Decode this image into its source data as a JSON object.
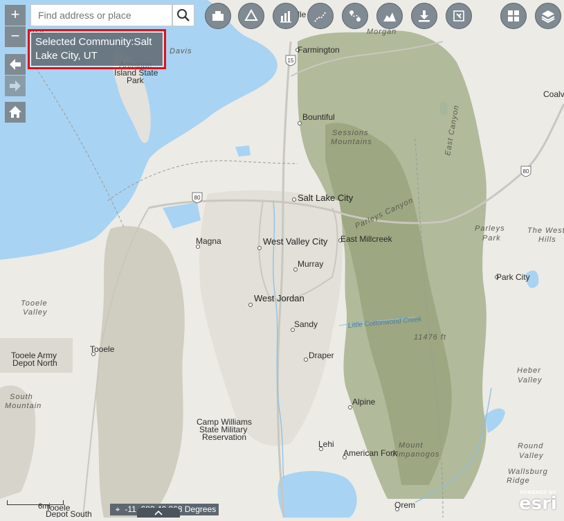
{
  "search": {
    "placeholder": "Find address or place"
  },
  "controls": {
    "zoom_in": "+",
    "zoom_out": "−"
  },
  "popup": {
    "text": "Selected Community:Salt Lake City, UT"
  },
  "coordinates": {
    "text": "-11 .683 40.868 Degrees"
  },
  "scale": {
    "label": "6mi"
  },
  "attribution": {
    "powered_by": "POWERED BY",
    "brand": "esri"
  },
  "colors": {
    "water": "#a9d3f2",
    "land": "#ecebe6",
    "mountain": "#9fab83",
    "control": "#7f8a93",
    "popup_border": "#e0121b"
  },
  "toolbar": [
    {
      "name": "basemap-gallery-icon"
    },
    {
      "name": "measure-icon"
    },
    {
      "name": "chart-icon"
    },
    {
      "name": "route-icon"
    },
    {
      "name": "directions-icon"
    },
    {
      "name": "elevation-profile-icon"
    },
    {
      "name": "download-icon"
    },
    {
      "name": "query-icon"
    }
  ],
  "toolbar_right": [
    {
      "name": "widget-grid-icon"
    },
    {
      "name": "layers-icon"
    }
  ],
  "labels": {
    "davis": "Davis",
    "morgan": "Morgan",
    "kaysville": "Kaysville",
    "farmington": "Farmington",
    "antelope": "Antelope",
    "island_state": "Island State",
    "park": "Park",
    "coalville": "Coalvill",
    "bountiful": "Bountiful",
    "sessions": "Sessions",
    "mountains": "Mountains",
    "east_canyon": "East Canyon",
    "salt_lake_city": "Salt Lake City",
    "parleys_canyon": "Parleys Canyon",
    "parleys_park": "Parleys",
    "park2": "Park",
    "the_west": "The West",
    "hills": "Hills",
    "magna": "Magna",
    "west_valley_city": "West Valley City",
    "east_millcreek": "East Millcreek",
    "murray": "Murray",
    "park_city": "Park City",
    "tooele_valley_1": "Tooele",
    "tooele_valley_2": "Valley",
    "west_jordan": "West Jordan",
    "sandy": "Sandy",
    "little_cottonwood": "Little Cottonwood Creek",
    "elev_11476": "11476 ft",
    "tooele_army_1": "Tooele Army",
    "tooele_army_2": "Depot North",
    "tooele": "Tooele",
    "draper": "Draper",
    "heber_1": "Heber",
    "heber_2": "Valley",
    "south_mtn_1": "South",
    "south_mtn_2": "Mountain",
    "alpine": "Alpine",
    "camp_williams_1": "Camp Williams",
    "camp_williams_2": "State Military",
    "camp_williams_3": "Reservation",
    "round_valley_1": "Round",
    "round_valley_2": "Valley",
    "mount_timp_1": "Mount",
    "mount_timp_2": "Timpanogos",
    "lehi": "Lehi",
    "american_fork": "American Fork",
    "wallsburg_1": "Wallsburg",
    "wallsburg_2": "Ridge",
    "tooele_depot_south_1": "Tooele",
    "tooele_depot_south_2": "Depot South",
    "orem": "Orem",
    "i15": "15",
    "i80_a": "80",
    "i80_b": "80",
    "treat": "reat"
  }
}
